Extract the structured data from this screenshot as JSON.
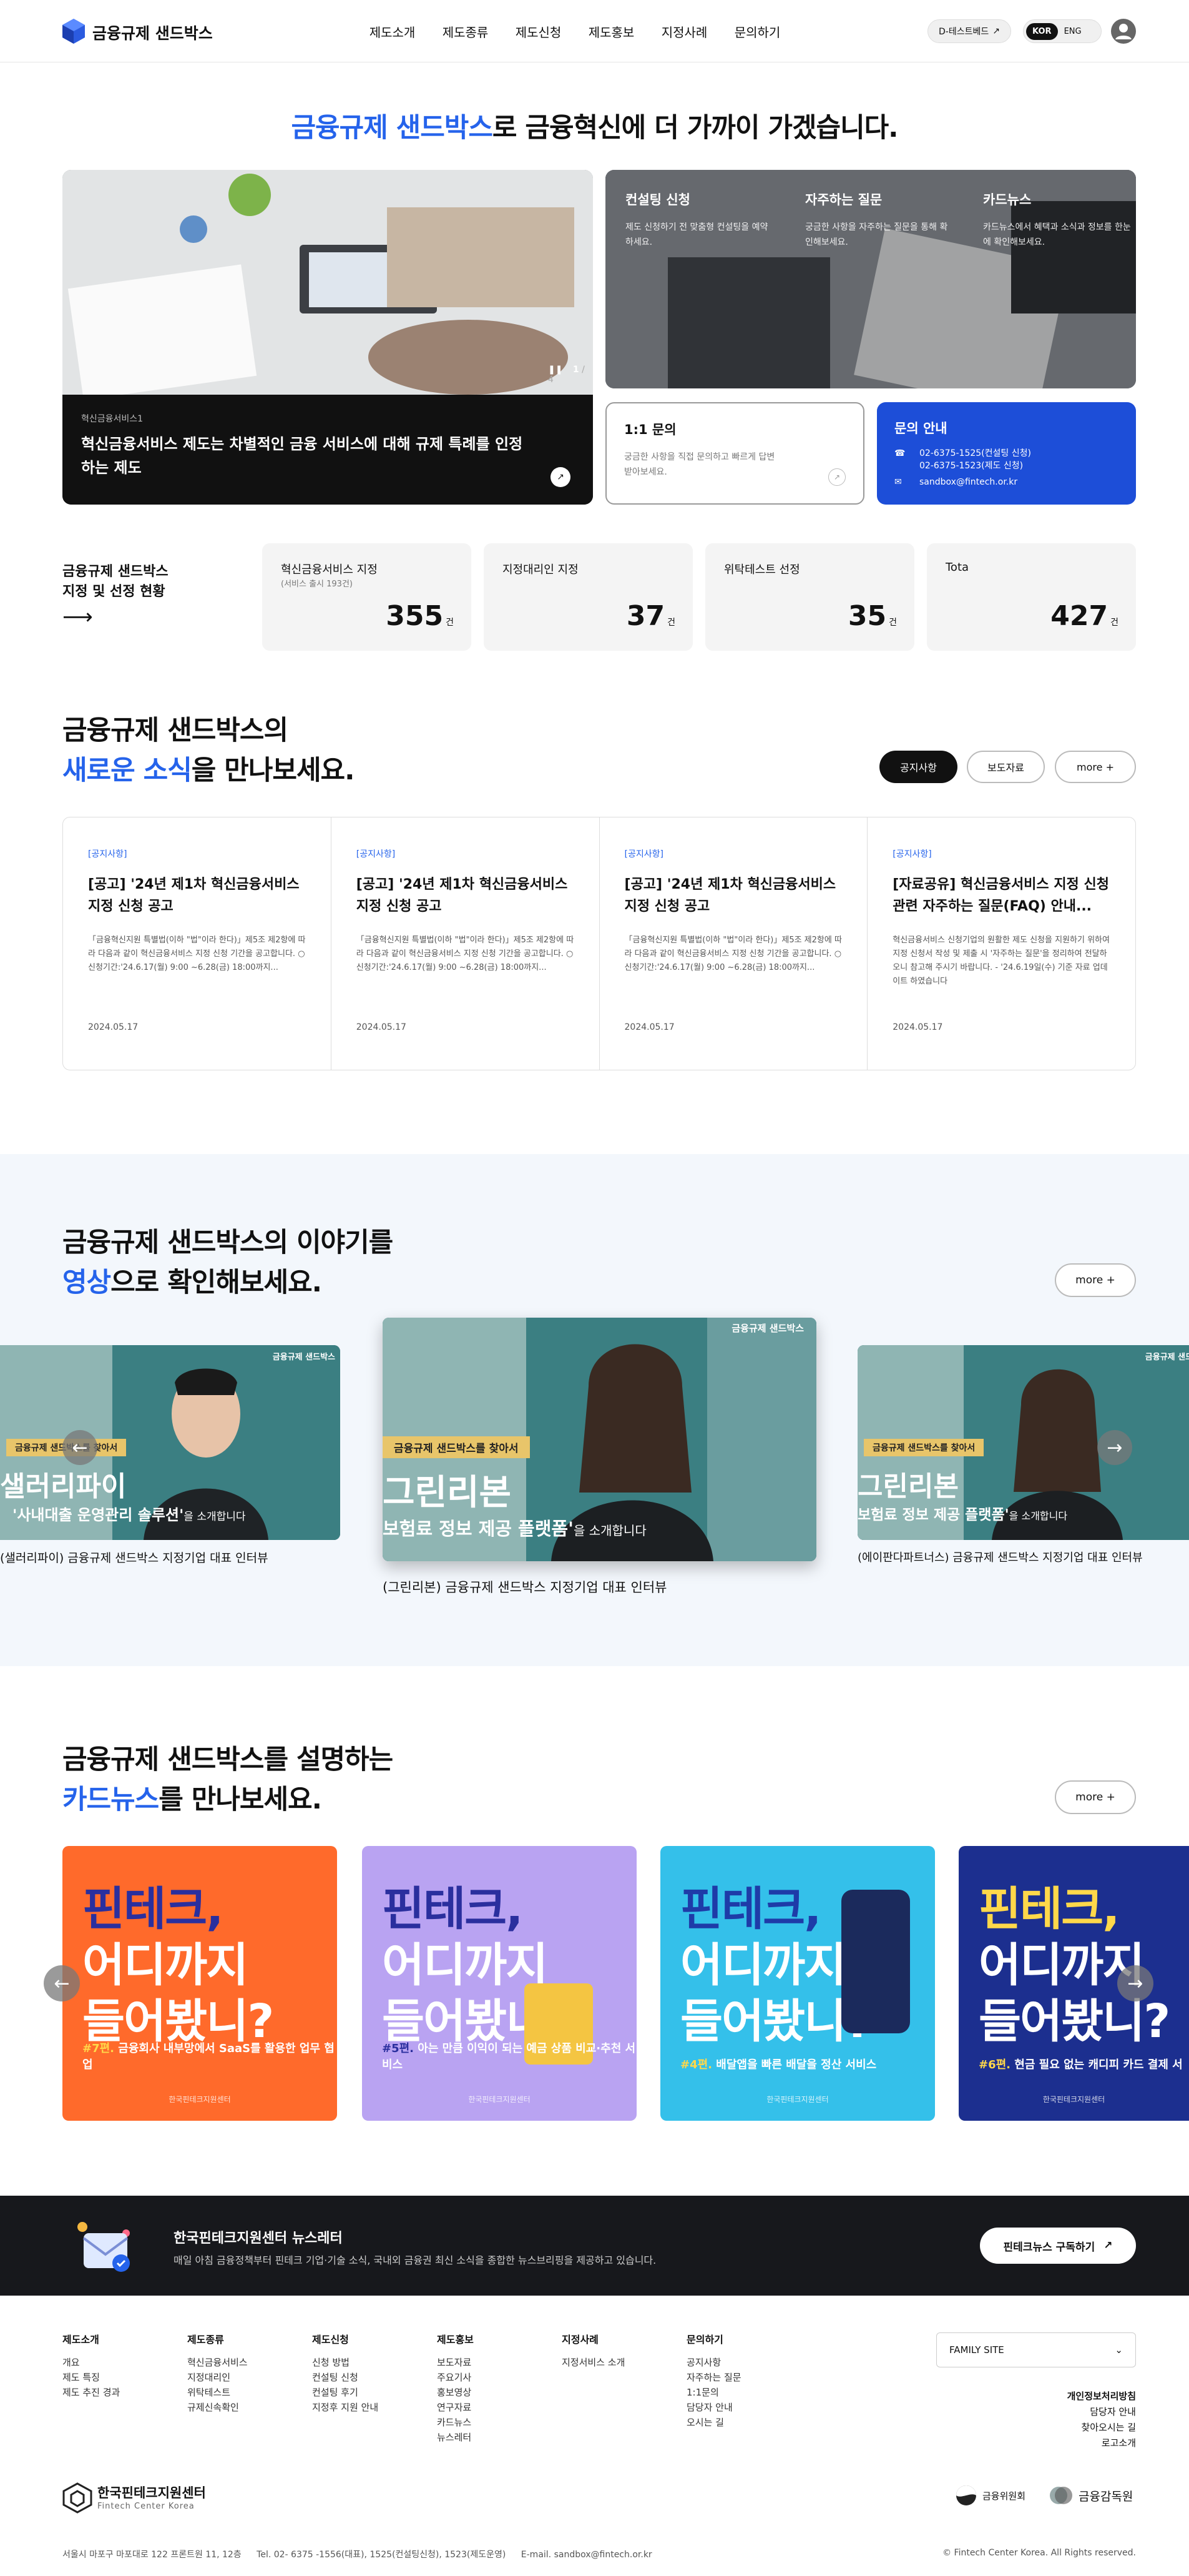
{
  "header": {
    "logo_text": "금융규제 샌드박스",
    "nav": [
      "제도소개",
      "제도종류",
      "제도신청",
      "제도홍보",
      "지정사례",
      "문의하기"
    ],
    "test_bed_button": "D-테스트베드",
    "lang": {
      "active": "KOR",
      "other": "ENG"
    }
  },
  "hero": {
    "title_highlight": "금융규제 샌드박스",
    "title_rest": "로 금융혁신에 더 가까이 가겠습니다.",
    "slide": {
      "tag": "혁신금융서비스1",
      "title": "혁신금융서비스 제도는 차별적인 금융 서비스에 대해 규제 특례를 인정하는 제도",
      "counter_current": "1",
      "counter_total": "/ 4"
    },
    "menu": [
      {
        "title": "컨설팅 신청",
        "desc": "제도 신청하기 전 맞춤형 컨설팅을 예약하세요."
      },
      {
        "title": "자주하는 질문",
        "desc": "궁금한 사항을 자주하는 질문을 통해 확인해보세요."
      },
      {
        "title": "카드뉴스",
        "desc": "카드뉴스에서 혜택과 소식과 정보를 한눈에 확인해보세요."
      }
    ],
    "inquiry": {
      "title": "1:1 문의",
      "desc": "궁금한 사항을 직접 문의하고 빠르게 답변 받아보세요."
    },
    "contact": {
      "title": "문의 안내",
      "phone1": "02-6375-1525(컨설팅 신청)",
      "phone2": "02-6375-1523(제도 신청)",
      "email": "sandbox@fintech.or.kr"
    }
  },
  "stats": {
    "title_line1": "금융규제 샌드박스",
    "title_line2": "지정 및 선정 현황",
    "items": [
      {
        "label": "혁신금융서비스 지정",
        "sub": "(서비스 출시 193건)",
        "value": "355",
        "unit": "건"
      },
      {
        "label": "지정대리인 지정",
        "sub": "",
        "value": "37",
        "unit": "건"
      },
      {
        "label": "위탁테스트 선정",
        "sub": "",
        "value": "35",
        "unit": "건"
      },
      {
        "label": "Tota",
        "sub": "",
        "value": "427",
        "unit": "건"
      }
    ]
  },
  "news": {
    "title_line1": "금융규제 샌드박스의",
    "title_highlight": "새로운 소식",
    "title_rest": "을 만나보세요.",
    "tabs": [
      "공지사항",
      "보도자료",
      "more +"
    ],
    "items": [
      {
        "cat": "[공지사항]",
        "title": "[공고] '24년 제1차 혁신금융서비스 지정 신청 공고",
        "desc": "「금융혁신지원 특별법(이하 \"법\"이라 한다)」제5조 제2항에 따라 다음과 같이 혁신금융서비스 지정 신청 기간을 공고합니다. ○ 신청기간:'24.6.17(월) 9:00 ~6.28(금) 18:00까지...",
        "date": "2024.05.17"
      },
      {
        "cat": "[공지사항]",
        "title": "[공고] '24년 제1차 혁신금융서비스 지정 신청 공고",
        "desc": "「금융혁신지원 특별법(이하 \"법\"이라 한다)」제5조 제2항에 따라 다음과 같이 혁신금융서비스 지정 신청 기간을 공고합니다. ○ 신청기간:'24.6.17(월) 9:00 ~6.28(금) 18:00까지...",
        "date": "2024.05.17"
      },
      {
        "cat": "[공지사항]",
        "title": "[공고] '24년 제1차 혁신금융서비스 지정 신청 공고",
        "desc": "「금융혁신지원 특별법(이하 \"법\"이라 한다)」제5조 제2항에 따라 다음과 같이 혁신금융서비스 지정 신청 기간을 공고합니다. ○ 신청기간:'24.6.17(월) 9:00 ~6.28(금) 18:00까지...",
        "date": "2024.05.17"
      },
      {
        "cat": "[공지사항]",
        "title": "[자료공유] 혁신금융서비스 지정 신청 관련 자주하는 질문(FAQ) 안내...",
        "desc": "혁신금융서비스 신청기업의 원활한 제도 신청을 지원하기 위하여 지정 신청서 작성 및 제출 시 '자주하는 질문'을 정리하여 전달하오니 참고해 주시기 바랍니다. - '24.6.19일(수) 기준 자료 업데이트 하였습니다",
        "date": "2024.05.17"
      }
    ]
  },
  "video": {
    "title_line1": "금융규제 샌드박스의 이야기를",
    "title_highlight": "영상",
    "title_rest": "으로 확인해보세요.",
    "more": "more +",
    "badge": "금융규제 샌드박스",
    "items": [
      {
        "tagline": "금융규제 샌드박스를 찾아서",
        "name": "샐러리파이",
        "slogan": "'사내대출 운영관리 솔루션'",
        "suffix": "을 소개합니다",
        "caption": "(샐러리파이) 금융규제 샌드박스 지정기업 대표 인터뷰"
      },
      {
        "tagline": "금융규제 샌드박스를 찾아서",
        "name": "그린리본",
        "slogan": "보험료 정보 제공 플랫폼'",
        "suffix": "을 소개합니다",
        "caption": "(그린리본) 금융규제 샌드박스 지정기업 대표 인터뷰"
      },
      {
        "tagline": "금융규제 샌드박스를 찾아서",
        "name": "그린리본",
        "slogan": "보험료 정보 제공 플랫폼'",
        "suffix": "을 소개합니다",
        "caption": "(에이판다파트너스) 금융규제 샌드박스 지정기업 대표 인터뷰"
      }
    ]
  },
  "cardnews": {
    "title_line1": "금융규제 샌드박스를 설명하는",
    "title_highlight": "카드뉴스",
    "title_rest": "를 만나보세요.",
    "more": "more +",
    "headline": [
      "핀테크,",
      "어디까지",
      "들어봤니?"
    ],
    "items": [
      {
        "episode": "#7편.",
        "text": "금융회사 내부망에서 SaaS를 활용한 업무 협업",
        "bg": "#ff6a2b"
      },
      {
        "episode": "#5편.",
        "text": "아는 만큼 이익이 되는 예금 상품 비교·추천 서비스",
        "bg": "#b9a3f2"
      },
      {
        "episode": "#4편.",
        "text": "배달앱을 빠른 배달을 정산 서비스",
        "bg": "#34c0ea"
      },
      {
        "episode": "#6편.",
        "text": "현금 필요 없는 캐디피 카드 결제 서",
        "bg": "#1c2f8f"
      }
    ],
    "footer_logo": "한국핀테크지원센터"
  },
  "newsletter": {
    "title": "한국핀테크지원센터 뉴스레터",
    "desc": "매일 아침 금융정책부터 핀테크 기업·기술 소식, 국내외 금융권 최신 소식을 종합한 뉴스브리핑을 제공하고 있습니다.",
    "button": "핀테크뉴스 구독하기"
  },
  "footer": {
    "cols": [
      {
        "title": "제도소개",
        "items": [
          "개요",
          "제도 특징",
          "제도 추진 경과"
        ]
      },
      {
        "title": "제도종류",
        "items": [
          "혁신금융서비스",
          "지정대리인",
          "위탁테스트",
          "규제신속확인"
        ]
      },
      {
        "title": "제도신청",
        "items": [
          "신청 방법",
          "컨설팅 신청",
          "컨설팅 후기",
          "지정후 지원 안내"
        ]
      },
      {
        "title": "제도홍보",
        "items": [
          "보도자료",
          "주요기사",
          "홍보영상",
          "연구자료",
          "카드뉴스",
          "뉴스레터"
        ]
      },
      {
        "title": "지정사례",
        "items": [
          "지정서비스 소개"
        ]
      },
      {
        "title": "문의하기",
        "items": [
          "공지사항",
          "자주하는 질문",
          "1:1문의",
          "담당자 안내",
          "오시는 길"
        ]
      }
    ],
    "family_site": "FAMILY SITE",
    "right_links": [
      "개인정보처리방침",
      "담당자 안내",
      "찾아오시는 길",
      "로고소개"
    ],
    "org_name": "한국핀테크지원센터",
    "org_name_en": "Fintech Center Korea",
    "partner1": "금융위원회",
    "partner2": "금융감독원",
    "address": "서울시 마포구 마포대로 122 프론트원 11, 12층",
    "tel": "Tel. 02- 6375 -1556(대표), 1525(컨설팅신청), 1523(제도운영)",
    "email": "E-mail. sandbox@fintech.or.kr",
    "copyright": "© Fintech Center Korea. All Rights reserved."
  },
  "colors": {
    "accent": "#2563eb",
    "contact_bg": "#1d4ed8",
    "dark": "#17181c"
  }
}
